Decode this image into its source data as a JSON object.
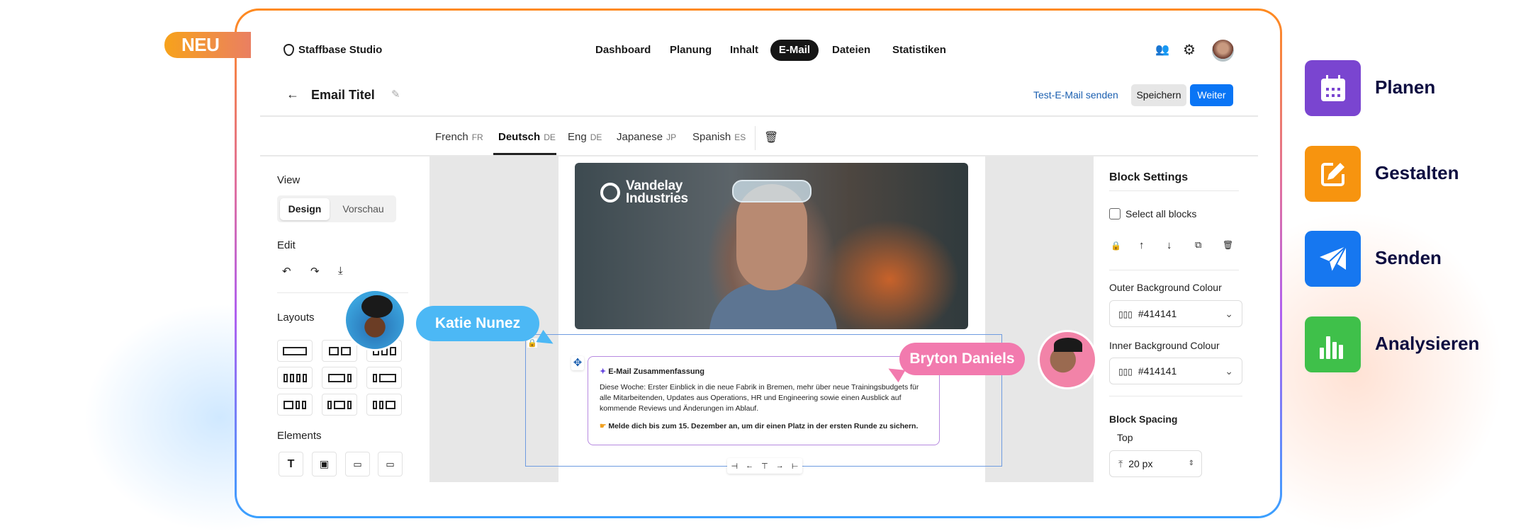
{
  "badge": "NEU",
  "app": {
    "logo": "Staffbase Studio",
    "nav": [
      "Dashboard",
      "Planung",
      "Inhalt",
      "E-Mail",
      "Dateien",
      "Statistiken"
    ],
    "active_nav": "E-Mail"
  },
  "header": {
    "title": "Email Titel",
    "test_email": "Test-E-Mail senden",
    "save": "Speichern",
    "next": "Weiter"
  },
  "languages": [
    {
      "name": "French",
      "code": "FR"
    },
    {
      "name": "Deutsch",
      "code": "DE",
      "active": true
    },
    {
      "name": "Eng",
      "code": "DE"
    },
    {
      "name": "Japanese",
      "code": "JP"
    },
    {
      "name": "Spanish",
      "code": "ES"
    }
  ],
  "sidebar": {
    "view": "View",
    "design": "Design",
    "preview": "Vorschau",
    "edit": "Edit",
    "layouts": "Layouts",
    "elements": "Elements"
  },
  "email": {
    "brand_line1": "Vandelay",
    "brand_line2": "Industries",
    "summary_title": "E-Mail Zusammenfassung",
    "summary_body": "Diese Woche: Erster Einblick in die neue Fabrik in Bremen, mehr über neue Trainingsbudgets für alle Mitarbeitenden, Updates aus Operations, HR und Engineering sowie einen Ausblick auf kommende Reviews und Änderungen im Ablauf.",
    "summary_cta": "Melde dich bis zum 15. Dezember an, um dir einen Platz in der ersten Runde zu sichern."
  },
  "collaborators": [
    {
      "name": "Katie Nunez",
      "color": "#4cb8f5"
    },
    {
      "name": "Bryton Daniels",
      "color": "#f27aae"
    }
  ],
  "block_settings": {
    "title": "Block Settings",
    "select_all": "Select all blocks",
    "outer_label": "Outer Background Colour",
    "outer_value": "#414141",
    "inner_label": "Inner Background Colour",
    "inner_value": "#414141",
    "spacing": "Block Spacing",
    "top": "Top",
    "top_value": "20 px"
  },
  "features": [
    {
      "label": "Planen",
      "color": "#7a45d0"
    },
    {
      "label": "Gestalten",
      "color": "#f7940f"
    },
    {
      "label": "Senden",
      "color": "#1677f0"
    },
    {
      "label": "Analysieren",
      "color": "#3fc04a"
    }
  ]
}
